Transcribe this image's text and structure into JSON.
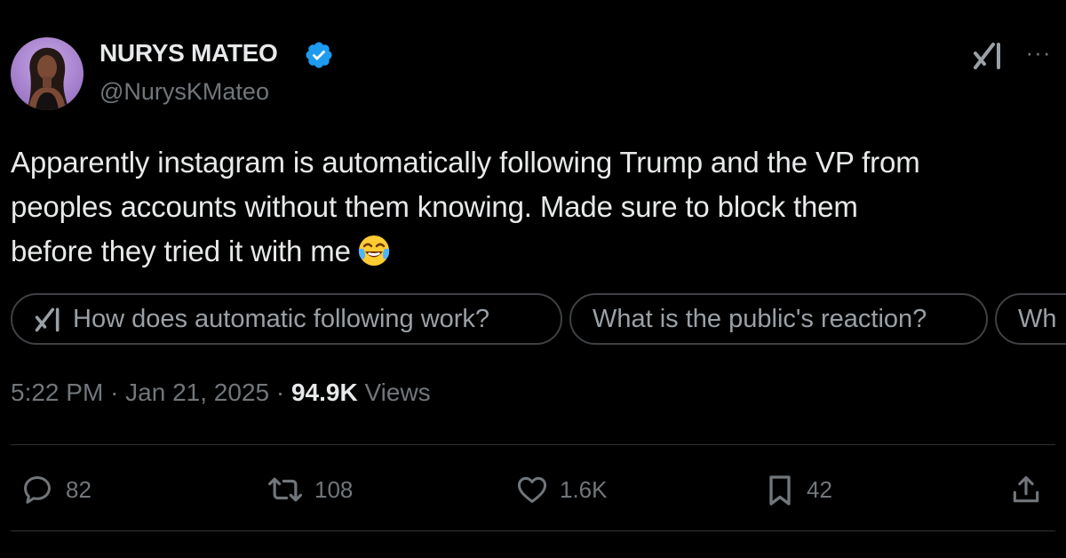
{
  "author": {
    "display_name": "NURYS MATEO",
    "handle": "@NurysKMateo",
    "verified": true
  },
  "tweet": {
    "text_line_1": "Apparently instagram is automatically following Trump and the VP from",
    "text_line_2": "peoples accounts without them knowing. Made sure to block them",
    "text_line_3": "before they tried it with me"
  },
  "grok_suggestions": [
    "How does automatic following work?",
    "What is the public's reaction?",
    "Wh"
  ],
  "meta": {
    "time": "5:22 PM",
    "separator": "·",
    "date": "Jan 21, 2025",
    "views_count": "94.9K",
    "views_label": "Views"
  },
  "actions": {
    "replies": "82",
    "reposts": "108",
    "likes": "1.6K",
    "bookmarks": "42"
  },
  "colors": {
    "background": "#000000",
    "text_primary": "#e7e9ea",
    "text_secondary": "#71767b",
    "verified_blue": "#1d9bf0",
    "divider": "#2f3336"
  },
  "icons": [
    "verified-badge-icon",
    "grok-icon",
    "more-icon",
    "reply-icon",
    "repost-icon",
    "like-icon",
    "bookmark-icon",
    "share-icon",
    "tears-of-joy-emoji"
  ]
}
